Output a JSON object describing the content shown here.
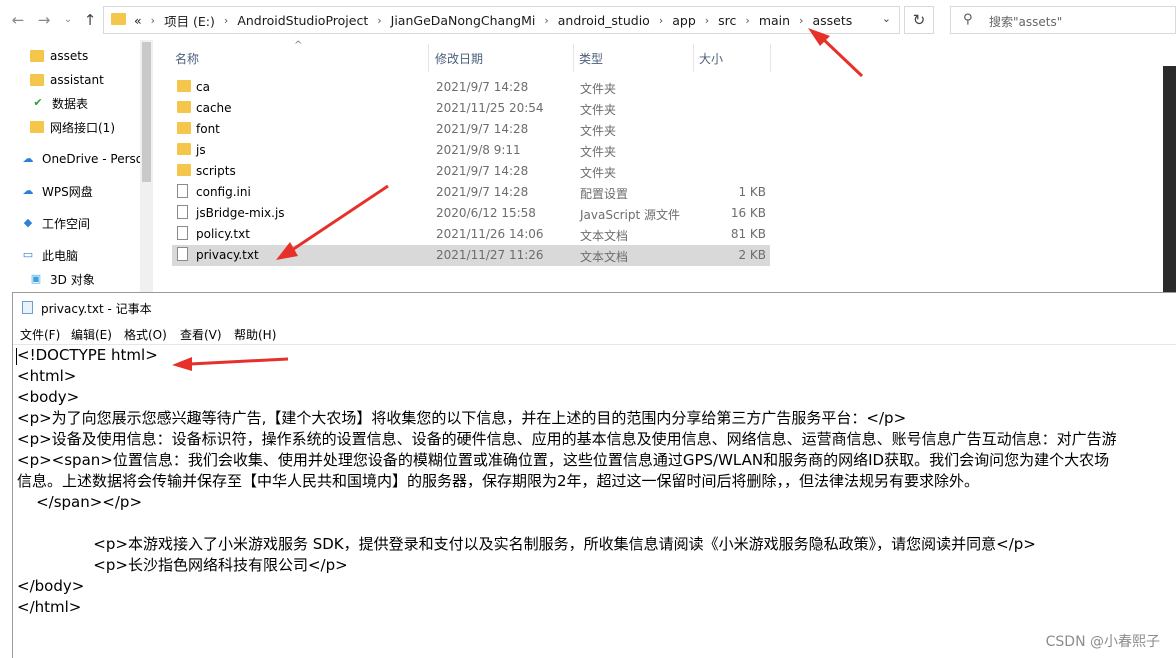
{
  "explorer": {
    "breadcrumb": [
      "«",
      "项目 (E:)",
      "AndroidStudioProject",
      "JianGeDaNongChangMi",
      "android_studio",
      "app",
      "src",
      "main",
      "assets"
    ],
    "search_placeholder": "搜索\"assets\"",
    "nav_items": [
      {
        "label": "assets",
        "icon": "folder-icon"
      },
      {
        "label": "assistant",
        "icon": "folder-icon"
      },
      {
        "label": "数据表",
        "icon": "synced-folder-icon"
      },
      {
        "label": "网络接口(1)",
        "icon": "folder-icon"
      },
      {
        "label": "OneDrive - Perso",
        "icon": "cloud-icon"
      },
      {
        "label": "WPS网盘",
        "icon": "cloud-icon"
      },
      {
        "label": "工作空间",
        "icon": "workspace-icon"
      },
      {
        "label": "此电脑",
        "icon": "computer-icon"
      },
      {
        "label": "3D 对象",
        "icon": "cube-icon"
      }
    ],
    "columns": {
      "name": "名称",
      "date": "修改日期",
      "type": "类型",
      "size": "大小"
    },
    "files": [
      {
        "name": "ca",
        "date": "2021/9/7 14:28",
        "type": "文件夹",
        "size": "",
        "kind": "folder"
      },
      {
        "name": "cache",
        "date": "2021/11/25 20:54",
        "type": "文件夹",
        "size": "",
        "kind": "folder"
      },
      {
        "name": "font",
        "date": "2021/9/7 14:28",
        "type": "文件夹",
        "size": "",
        "kind": "folder"
      },
      {
        "name": "js",
        "date": "2021/9/8 9:11",
        "type": "文件夹",
        "size": "",
        "kind": "folder"
      },
      {
        "name": "scripts",
        "date": "2021/9/7 14:28",
        "type": "文件夹",
        "size": "",
        "kind": "folder"
      },
      {
        "name": "config.ini",
        "date": "2021/9/7 14:28",
        "type": "配置设置",
        "size": "1 KB",
        "kind": "file"
      },
      {
        "name": "jsBridge-mix.js",
        "date": "2020/6/12 15:58",
        "type": "JavaScript 源文件",
        "size": "16 KB",
        "kind": "file"
      },
      {
        "name": "policy.txt",
        "date": "2021/11/26 14:06",
        "type": "文本文档",
        "size": "81 KB",
        "kind": "file"
      },
      {
        "name": "privacy.txt",
        "date": "2021/11/27 11:26",
        "type": "文本文档",
        "size": "2 KB",
        "kind": "file",
        "selected": true
      }
    ]
  },
  "notepad": {
    "title": "privacy.txt - 记事本",
    "menu": [
      "文件(F)",
      "编辑(E)",
      "格式(O)",
      "查看(V)",
      "帮助(H)"
    ],
    "lines": [
      "<!DOCTYPE html>",
      "<html>",
      "<body>",
      "<p>为了向您展示您感兴趣等待广告,【建个大农场】将收集您的以下信息，并在上述的目的范围内分享给第三方广告服务平台：</p>",
      "<p>设备及使用信息：设备标识符，操作系统的设置信息、设备的硬件信息、应用的基本信息及使用信息、网络信息、运营商信息、账号信息广告互动信息：对广告游",
      "<p><span>位置信息：我们会收集、使用并处理您设备的模糊位置或准确位置，这些位置信息通过GPS/WLAN和服务商的网络ID获取。我们会询问您为建个大农场",
      "信息。上述数据将会传输并保存至【中华人民共和国境内】的服务器，保存期限为2年，超过这一保留时间后将删除，，但法律法规另有要求除外。",
      "    </span></p>",
      "",
      "                <p>本游戏接入了小米游戏服务 SDK，提供登录和支付以及实名制服务，所收集信息请阅读《小米游戏服务隐私政策》，请您阅读并同意</p>",
      "                <p>长沙指色网络科技有限公司</p>",
      "</body>",
      "</html>"
    ]
  },
  "watermark": "CSDN @小春熙子",
  "colors": {
    "arrow": "#e8302a",
    "folder": "#f4c64c",
    "selected_row": "#d9d9d9"
  }
}
